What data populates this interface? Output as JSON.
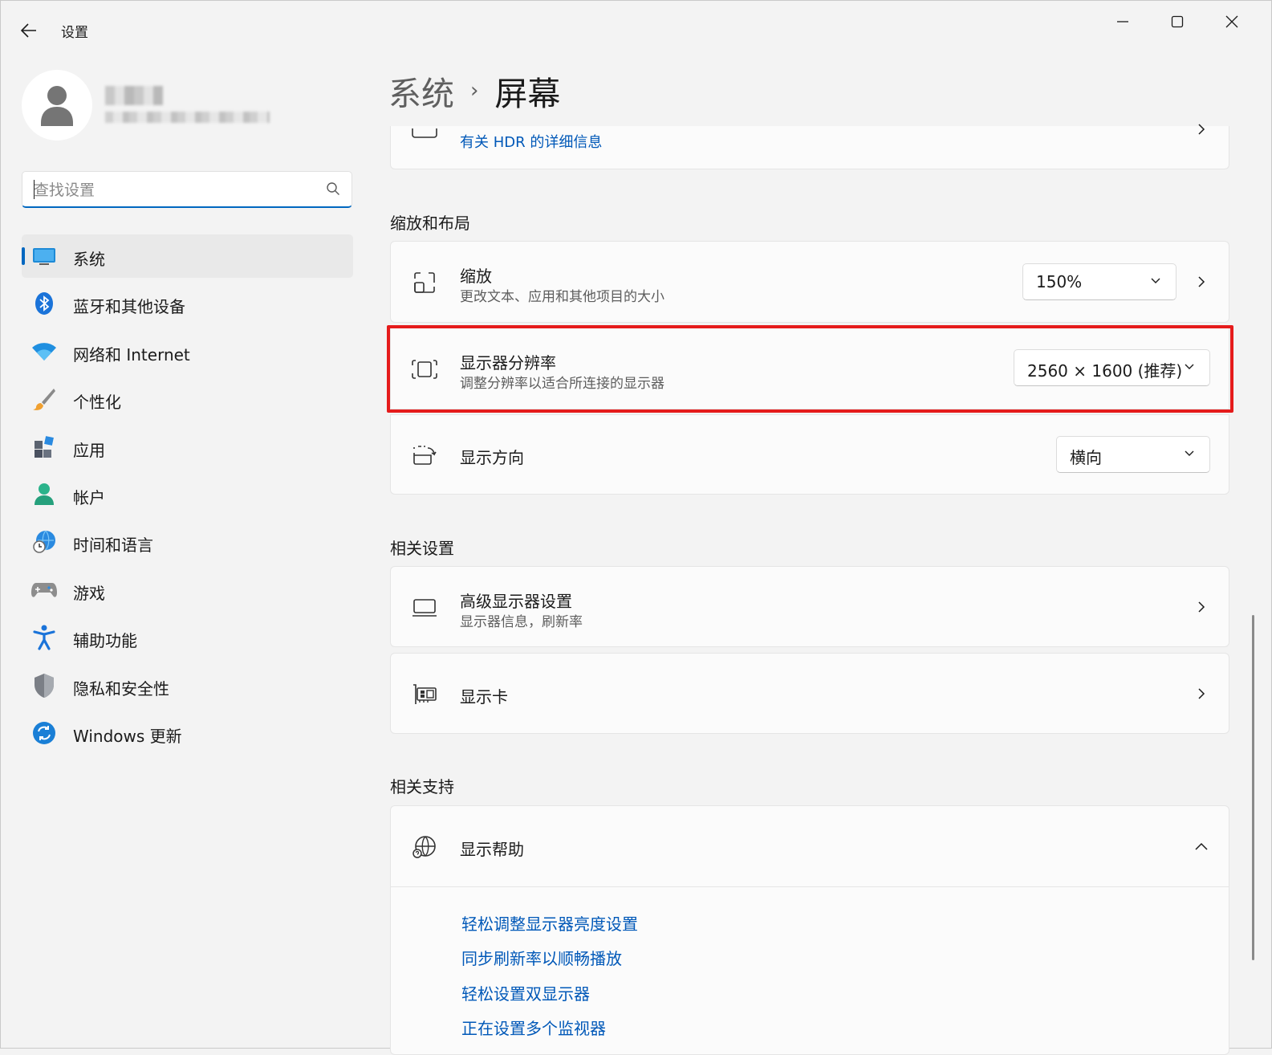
{
  "window": {
    "app_title": "设置",
    "controls": [
      "minimize",
      "maximize",
      "close"
    ]
  },
  "search": {
    "placeholder": "查找设置"
  },
  "sidebar": {
    "items": [
      {
        "label": "系统",
        "icon": "system-icon",
        "active": true
      },
      {
        "label": "蓝牙和其他设备",
        "icon": "bluetooth-icon"
      },
      {
        "label": "网络和 Internet",
        "icon": "wifi-icon"
      },
      {
        "label": "个性化",
        "icon": "brush-icon"
      },
      {
        "label": "应用",
        "icon": "apps-icon"
      },
      {
        "label": "帐户",
        "icon": "account-icon"
      },
      {
        "label": "时间和语言",
        "icon": "time-language-icon"
      },
      {
        "label": "游戏",
        "icon": "gamepad-icon"
      },
      {
        "label": "辅助功能",
        "icon": "accessibility-icon"
      },
      {
        "label": "隐私和安全性",
        "icon": "shield-icon"
      },
      {
        "label": "Windows 更新",
        "icon": "update-icon"
      }
    ]
  },
  "breadcrumb": {
    "parent": "系统",
    "separator": "›",
    "current": "屏幕"
  },
  "hdr_card": {
    "link": "有关 HDR 的详细信息"
  },
  "scale_layout": {
    "section_title": "缩放和布局",
    "scale": {
      "title": "缩放",
      "subtitle": "更改文本、应用和其他项目的大小",
      "value": "150%"
    },
    "resolution": {
      "title": "显示器分辨率",
      "subtitle": "调整分辨率以适合所连接的显示器",
      "value": "2560 × 1600 (推荐)"
    },
    "orientation": {
      "title": "显示方向",
      "value": "横向"
    }
  },
  "related_settings": {
    "section_title": "相关设置",
    "advanced": {
      "title": "高级显示器设置",
      "subtitle": "显示器信息，刷新率"
    },
    "graphics": {
      "title": "显示卡"
    }
  },
  "related_support": {
    "section_title": "相关支持",
    "help": {
      "title": "显示帮助"
    },
    "links": [
      "轻松调整显示器亮度设置",
      "同步刷新率以顺畅播放",
      "轻松设置双显示器",
      "正在设置多个监视器"
    ]
  },
  "colors": {
    "accent": "#0067c0",
    "highlight": "#e51b1b",
    "link": "#0058b8"
  }
}
